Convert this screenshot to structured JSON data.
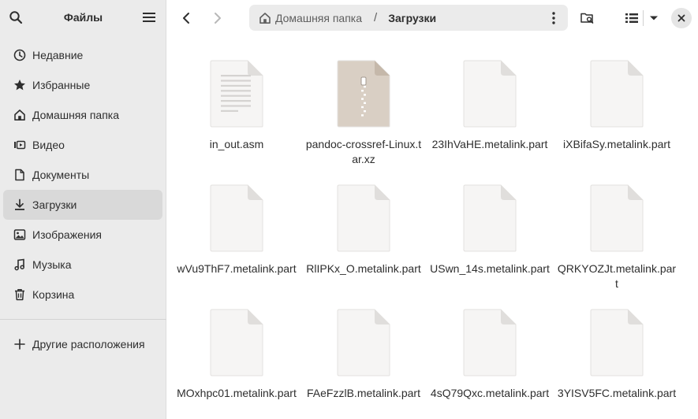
{
  "sidebar": {
    "title": "Файлы",
    "items": [
      {
        "label": "Недавние",
        "icon": "clock-icon",
        "name": "recent"
      },
      {
        "label": "Избранные",
        "icon": "star-icon",
        "name": "starred"
      },
      {
        "label": "Домашняя папка",
        "icon": "home-icon",
        "name": "home"
      },
      {
        "label": "Видео",
        "icon": "video-icon",
        "name": "videos"
      },
      {
        "label": "Документы",
        "icon": "document-icon",
        "name": "documents"
      },
      {
        "label": "Загрузки",
        "icon": "download-icon",
        "name": "downloads",
        "active": true
      },
      {
        "label": "Изображения",
        "icon": "image-icon",
        "name": "pictures"
      },
      {
        "label": "Музыка",
        "icon": "music-icon",
        "name": "music"
      },
      {
        "label": "Корзина",
        "icon": "trash-icon",
        "name": "trash"
      }
    ],
    "other_locations": {
      "label": "Другие расположения",
      "icon": "plus-icon"
    }
  },
  "header": {
    "path": {
      "home_label": "Домашняя папка",
      "separator": "/",
      "current": "Загрузки"
    }
  },
  "files": [
    {
      "name": "in_out.asm",
      "type": "text"
    },
    {
      "name": "pandoc-crossref-Linux.tar.xz",
      "type": "archive"
    },
    {
      "name": "23IhVaHE.metalink.part",
      "type": "blank"
    },
    {
      "name": "iXBifaSy.metalink.part",
      "type": "blank"
    },
    {
      "name": "wVu9ThF7.metalink.part",
      "type": "blank"
    },
    {
      "name": "RlIPKx_O.metalink.part",
      "type": "blank"
    },
    {
      "name": "USwn_14s.metalink.part",
      "type": "blank"
    },
    {
      "name": "QRKYOZJt.metalink.part",
      "type": "blank"
    },
    {
      "name": "MOxhpc01.metalink.part",
      "type": "blank"
    },
    {
      "name": "FAeFzzlB.metalink.part",
      "type": "blank"
    },
    {
      "name": "4sQ79Qxc.metalink.part",
      "type": "blank"
    },
    {
      "name": "3YISV5FC.metalink.part",
      "type": "blank"
    }
  ],
  "colors": {
    "sidebar_bg": "#ebebeb",
    "active_bg": "#d9d9d9",
    "page_fill": "#f6f5f4",
    "page_fold": "#e0dedc",
    "archive_fill": "#d9cfc4"
  }
}
